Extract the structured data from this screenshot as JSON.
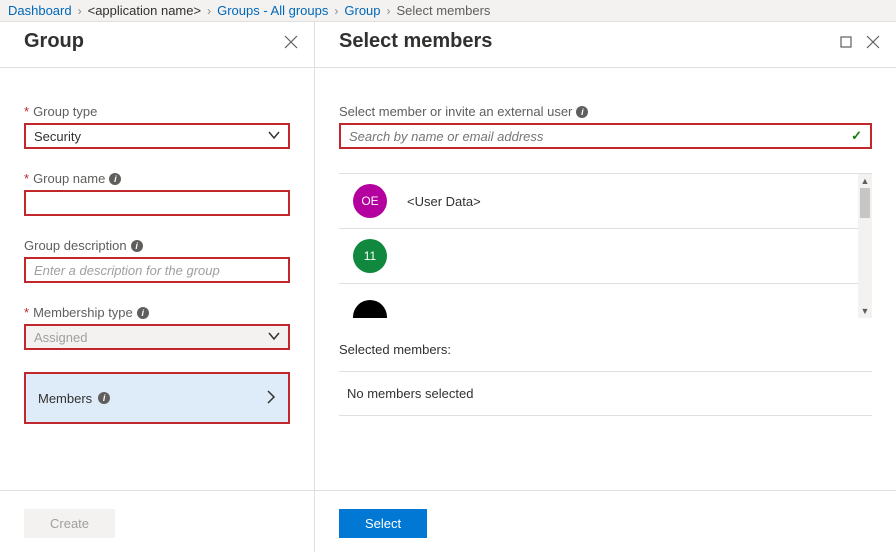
{
  "breadcrumb": {
    "dashboard": "Dashboard",
    "app": "<application name>",
    "groups": "Groups - All groups",
    "group": "Group",
    "current": "Select members"
  },
  "left": {
    "title": "Group",
    "group_type_label": "Group type",
    "group_type_value": "Security",
    "group_name_label": "Group name",
    "group_name_value": "",
    "description_label": "Group description",
    "description_placeholder": "Enter a description for the group",
    "membership_label": "Membership type",
    "membership_value": "Assigned",
    "members_label": "Members",
    "create_button": "Create"
  },
  "right": {
    "title": "Select members",
    "search_label": "Select member or invite an external user",
    "search_placeholder": "Search by name or email address",
    "members": [
      {
        "initials": "OE",
        "color": "magenta",
        "name": "<User Data>"
      },
      {
        "initials": "11",
        "color": "green",
        "name": ""
      },
      {
        "initials": "",
        "color": "black",
        "name": ""
      }
    ],
    "selected_label": "Selected members:",
    "no_members": "No members selected",
    "select_button": "Select"
  }
}
